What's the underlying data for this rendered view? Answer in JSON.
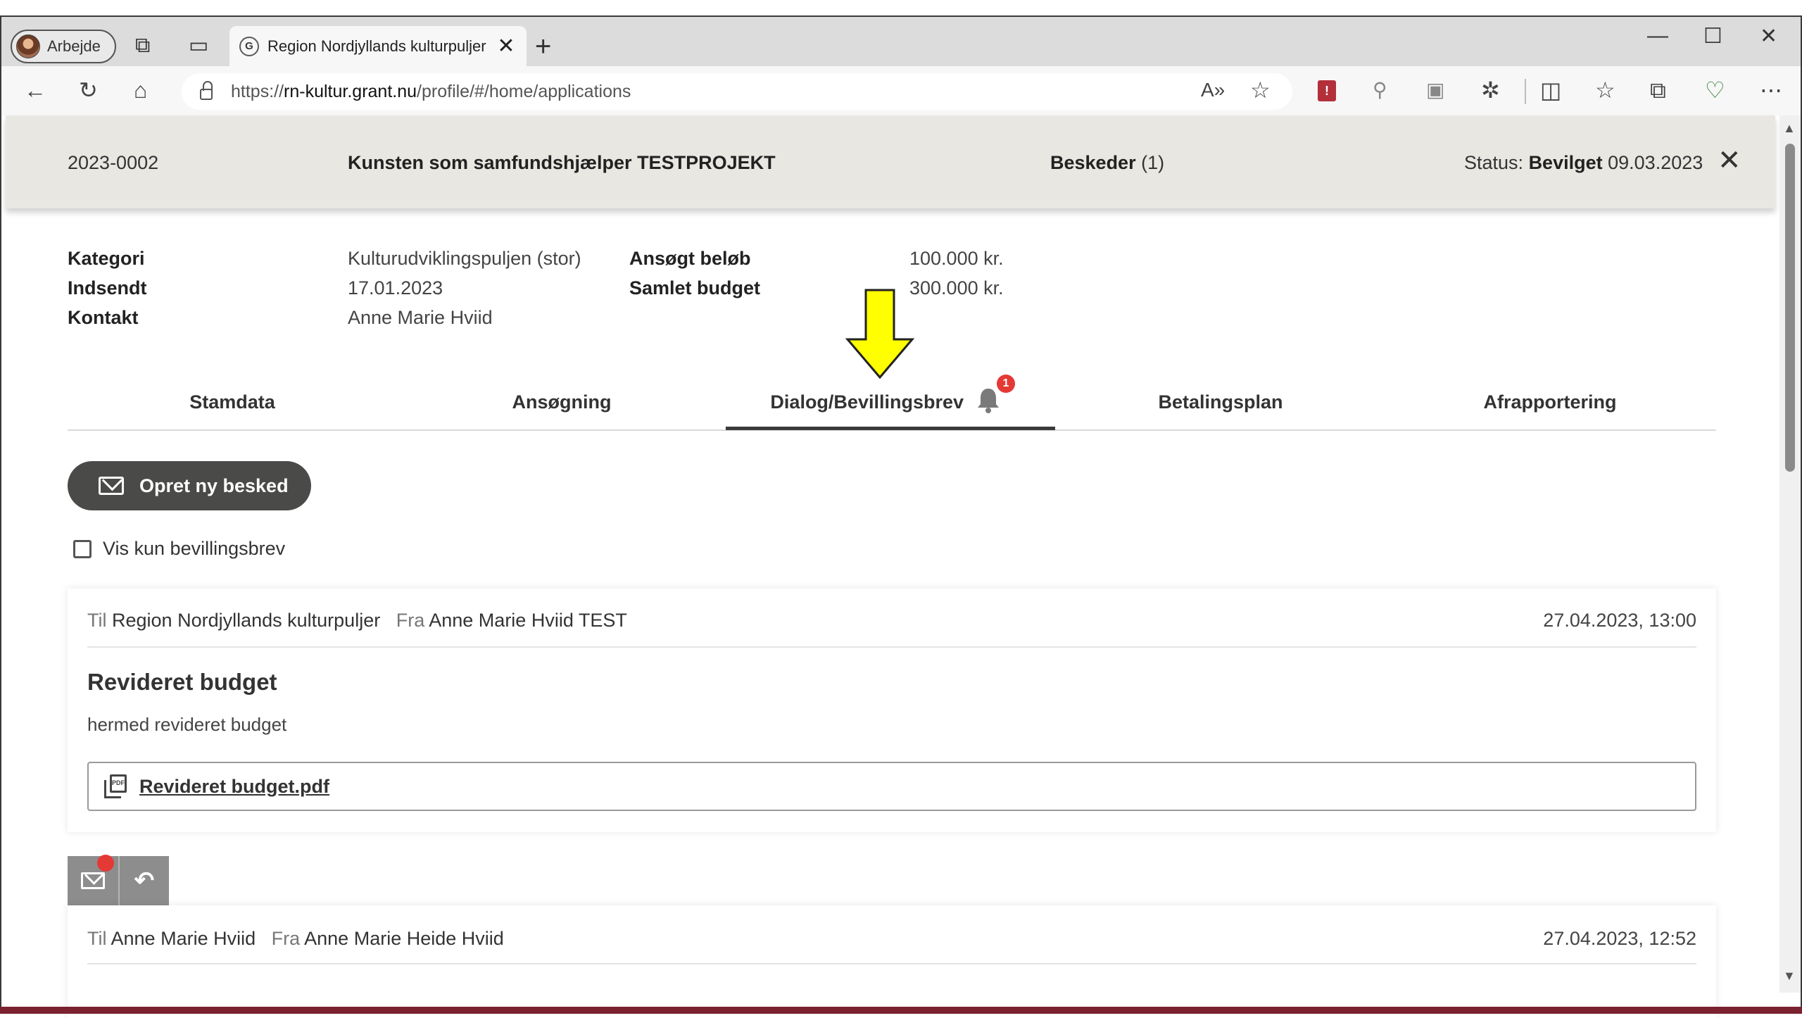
{
  "browser": {
    "profile_label": "Arbejde",
    "tab_title": "Region Nordjyllands kulturpuljer",
    "tab_favicon": "G",
    "tab_close": "✕",
    "new_tab": "+",
    "url_scheme": "https://",
    "url_host": "rn-kultur.grant.nu",
    "url_path": "/profile/#/home/applications",
    "window_minimize": "—",
    "window_maximize": "☐",
    "window_close": "✕",
    "more_menu": "⋯"
  },
  "header": {
    "case_number": "2023-0002",
    "project_title": "Kunsten som samfundshjælper TESTPROJEKT",
    "messages_label": "Beskeder",
    "messages_count": "(1)",
    "status_label": "Status:",
    "status_value": "Bevilget",
    "status_date": "09.03.2023",
    "close_label": "✕"
  },
  "info": {
    "kategori_label": "Kategori",
    "kategori_value": "Kulturudviklingspuljen (stor)",
    "indsendt_label": "Indsendt",
    "indsendt_value": "17.01.2023",
    "kontakt_label": "Kontakt",
    "kontakt_value": "Anne Marie Hviid",
    "ansogt_label": "Ansøgt beløb",
    "ansogt_value": "100.000 kr.",
    "budget_label": "Samlet budget",
    "budget_value": "300.000 kr."
  },
  "tabs": {
    "stamdata": "Stamdata",
    "ansogning": "Ansøgning",
    "dialog": "Dialog/Bevillingsbrev",
    "dialog_badge": "1",
    "betalingsplan": "Betalingsplan",
    "afrapportering": "Afrapportering",
    "active": "Dialog/Bevillingsbrev"
  },
  "actions": {
    "new_message": "Opret ny besked",
    "filter_checkbox_label": "Vis kun bevillingsbrev",
    "filter_checked": false
  },
  "messages": [
    {
      "to_prefix": "Til",
      "to": "Region Nordjyllands kulturpuljer",
      "from_prefix": "Fra",
      "from": "Anne Marie Hviid TEST",
      "date": "27.04.2023, 13:00",
      "subject": "Revideret budget",
      "body": "hermed revideret budget",
      "attachment": "Revideret budget.pdf"
    },
    {
      "to_prefix": "Til",
      "to": "Anne Marie Hviid",
      "from_prefix": "Fra",
      "from": "Anne Marie Heide Hviid",
      "date": "27.04.2023, 12:52"
    }
  ],
  "colors": {
    "header_band": "#e9e7e2",
    "button_dark": "#4a4a48",
    "badge_red": "#e53935",
    "annotation_arrow": "#ffff00",
    "bottom_strip": "#7a2230"
  }
}
